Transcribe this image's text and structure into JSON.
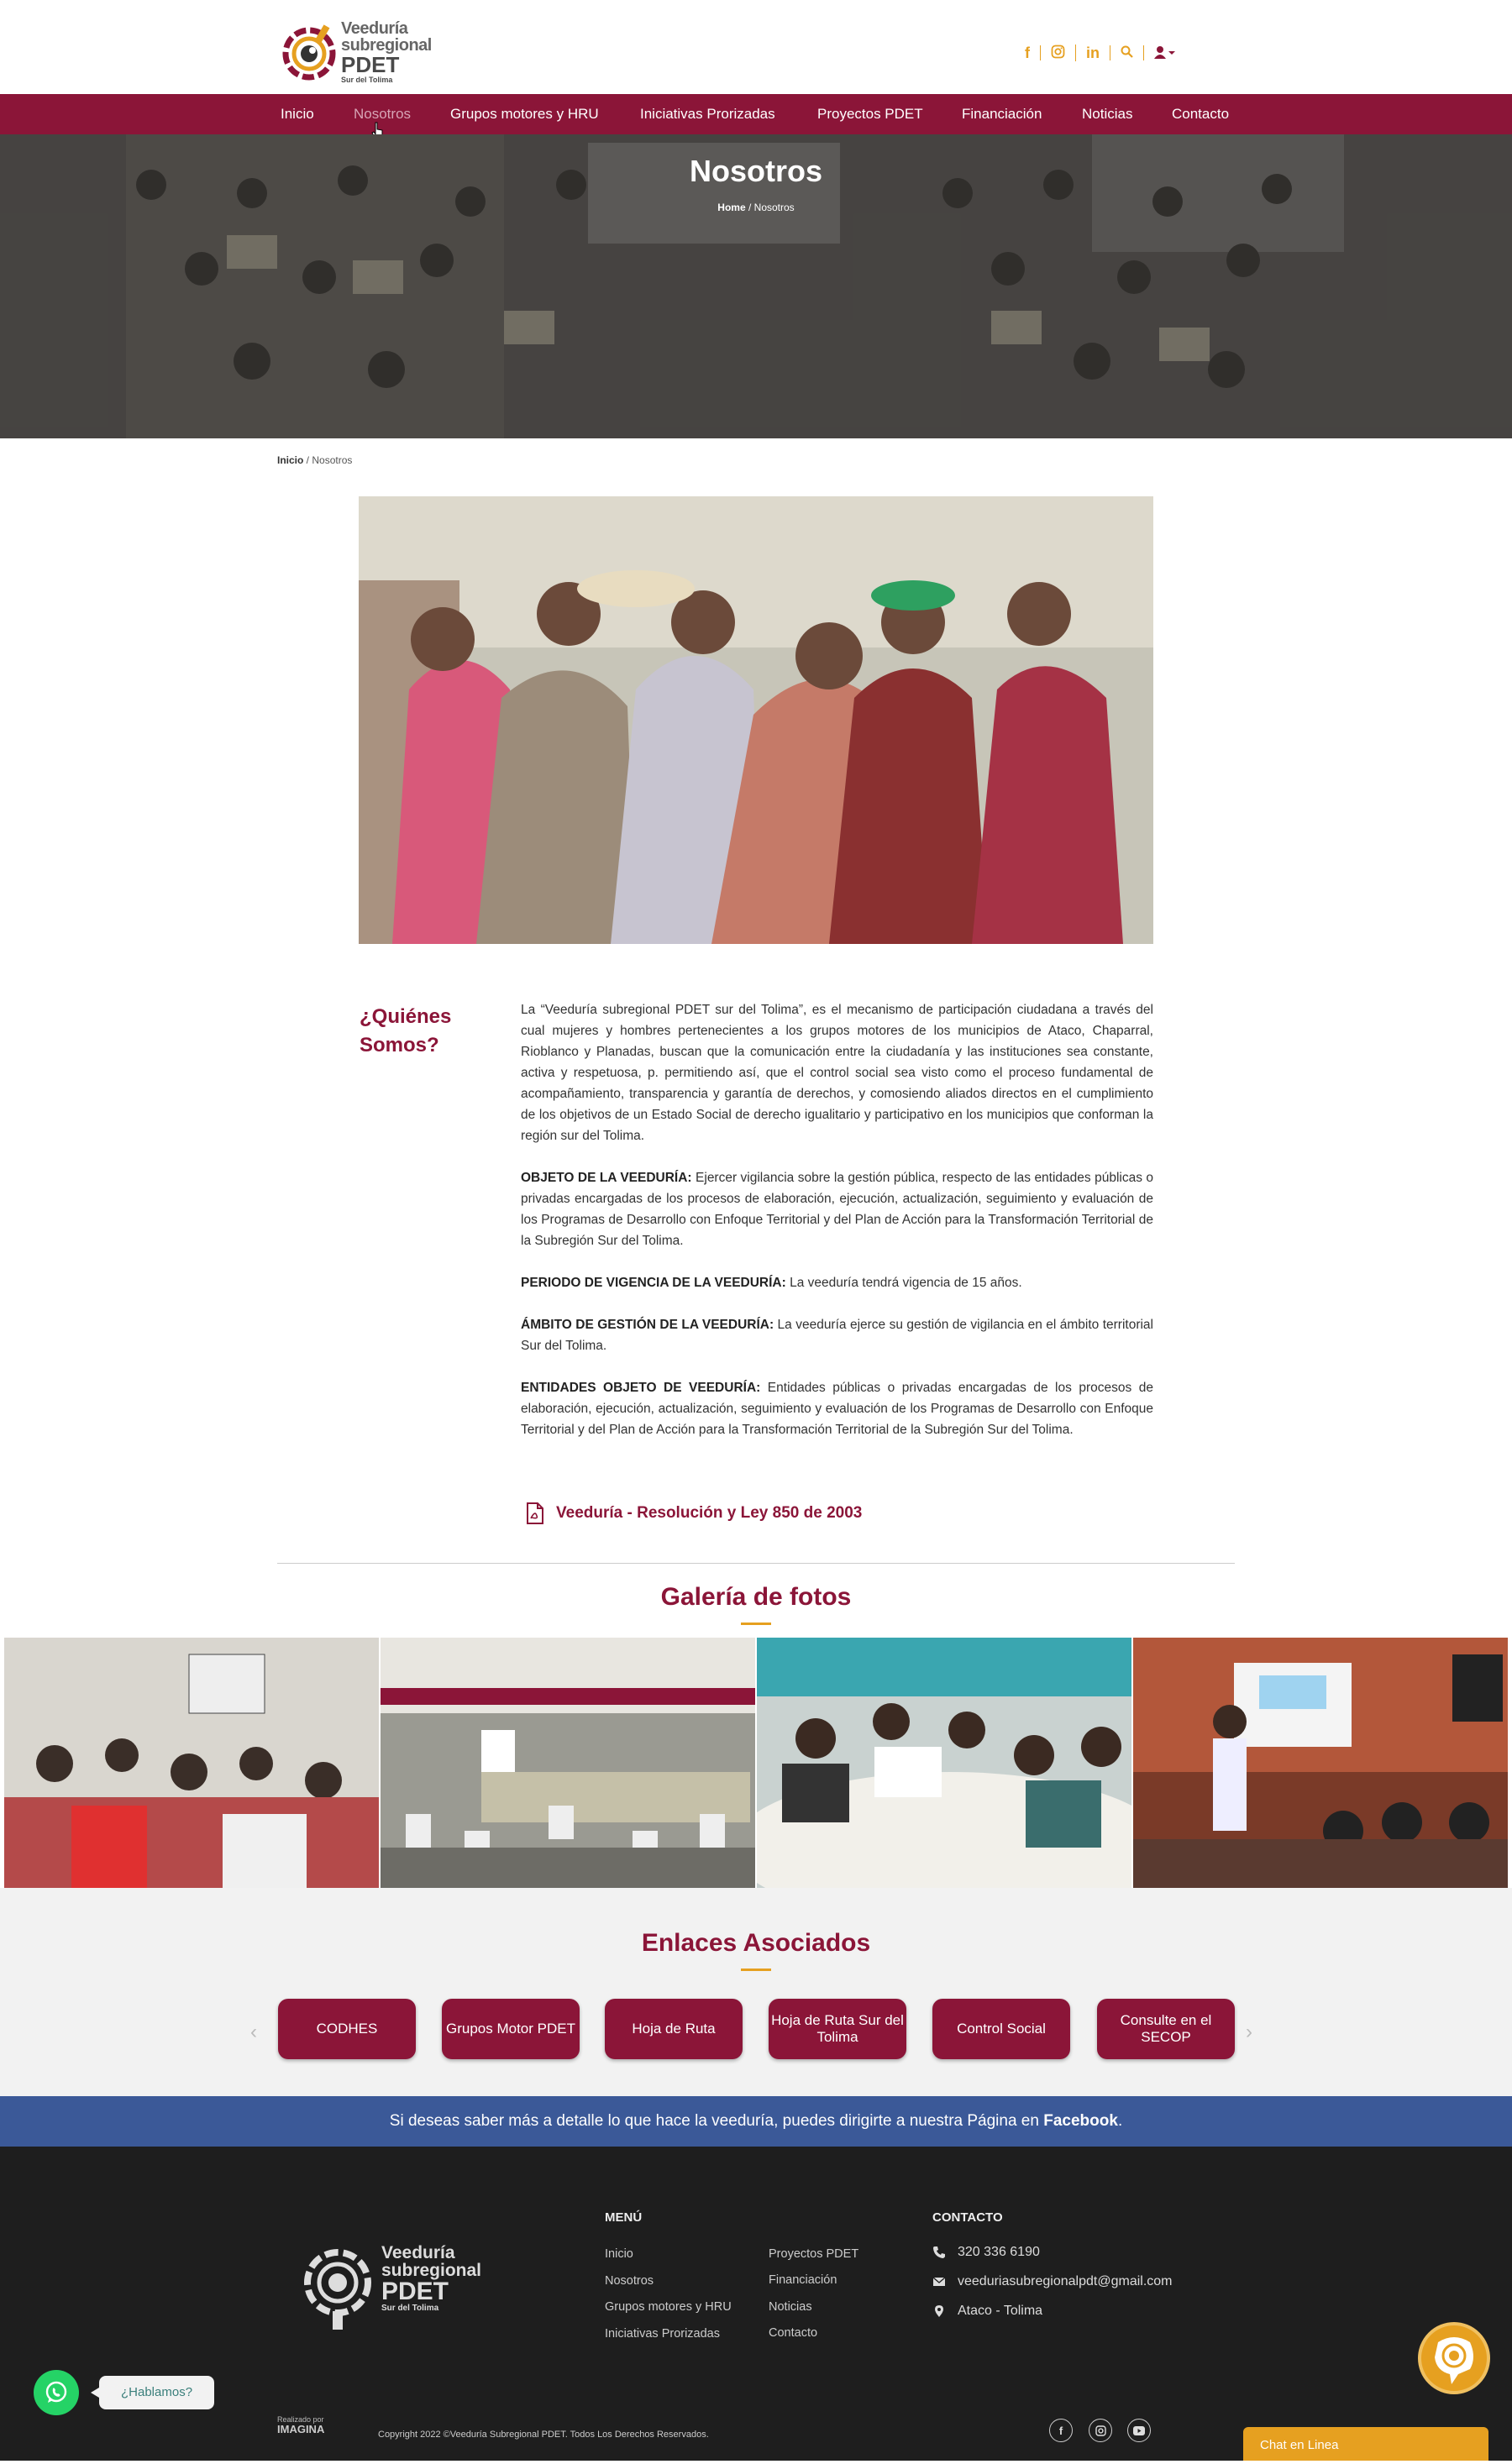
{
  "brand": {
    "line1": "Veeduría",
    "line2": "subregional",
    "line3": "PDET",
    "line4": "Sur del Tolima",
    "colors": {
      "primary": "#8b1538",
      "accent": "#e6a020",
      "facebook": "#3b5998",
      "footer": "#1e1e1e"
    }
  },
  "header_icons": [
    "facebook-icon",
    "instagram-icon",
    "linkedin-icon",
    "search-icon",
    "user-icon"
  ],
  "nav": {
    "items": [
      {
        "label": "Inicio"
      },
      {
        "label": "Nosotros",
        "active": true
      },
      {
        "label": "Grupos motores y HRU"
      },
      {
        "label": "Iniciativas Prorizadas"
      },
      {
        "label": "Proyectos PDET"
      },
      {
        "label": "Financiación"
      },
      {
        "label": "Noticias"
      },
      {
        "label": "Contacto"
      }
    ]
  },
  "hero": {
    "title": "Nosotros",
    "crumb_home": "Home",
    "crumb_sep": " / ",
    "crumb_current": "Nosotros"
  },
  "breadcrumb": {
    "home": "Inicio",
    "sep": " / ",
    "current": "Nosotros"
  },
  "about": {
    "heading": "¿Quiénes Somos?",
    "intro": "La “Veeduría subregional PDET sur del Tolima”, es el mecanismo de participación ciudadana a través del cual mujeres y hombres pertenecientes a los grupos motores de los municipios de Ataco, Chaparral, Rioblanco y Planadas, buscan que la comunicación entre la ciudadanía y las instituciones sea constante, activa y respetuosa, p.  permitiendo así, que el control social sea visto como el proceso fundamental de acompañamiento, transparencia y garantía de derechos, y comosiendo aliados directos en el cumplimiento de los objetivos de un Estado Social de derecho igualitario y participativo en los municipios que conforman la región sur del Tolima.",
    "blocks": [
      {
        "label": "OBJETO DE LA VEEDURÍA:",
        "text": " Ejercer vigilancia sobre la gestión pública, respecto de las entidades públicas o privadas encargadas de los procesos de elaboración, ejecución, actualización, seguimiento y evaluación de los Programas de Desarrollo con Enfoque Territorial y del Plan de Acción para la Transformación Territorial de la Subregión Sur del Tolima."
      },
      {
        "label": "PERIODO DE VIGENCIA DE LA VEEDURÍA:",
        "text": " La veeduría tendrá vigencia de 15 años."
      },
      {
        "label": "ÁMBITO DE GESTIÓN DE LA VEEDURÍA:",
        "text": " La veeduría ejerce su gestión de vigilancia en el ámbito territorial Sur del Tolima."
      },
      {
        "label": "ENTIDADES OBJETO DE VEEDURÍA:",
        "text": " Entidades públicas o privadas encargadas de los procesos de elaboración, ejecución, actualización, seguimiento y evaluación de los Programas de Desarrollo con Enfoque Territorial y del Plan de Acción para la Transformación Territorial de la Subregión Sur del Tolima."
      }
    ],
    "pdf_label": "Veeduría - Resolución y Ley 850 de 2003"
  },
  "gallery": {
    "title": "Galería de fotos"
  },
  "links": {
    "title": "Enlaces Asociados",
    "items": [
      {
        "label": "CODHES"
      },
      {
        "label": "Grupos Motor PDET"
      },
      {
        "label": "Hoja de Ruta"
      },
      {
        "label": "Hoja de Ruta Sur del Tolima"
      },
      {
        "label": "Control Social"
      },
      {
        "label": "Consulte en el SECOP"
      }
    ]
  },
  "facebook_bar": {
    "text": "Si deseas saber más a detalle lo que hace la veeduría, puedes dirigirte a nuestra Página en ",
    "link": "Facebook",
    "end": "."
  },
  "footer": {
    "menu_heading": "MENÚ",
    "menu_col1": [
      "Inicio",
      "Nosotros",
      "Grupos motores y HRU",
      "Iniciativas Prorizadas"
    ],
    "menu_col2": [
      "Proyectos PDET",
      "Financiación",
      "Noticias",
      "Contacto"
    ],
    "contact_heading": "CONTACTO",
    "phone": "320 336 6190",
    "email": "veeduriasubregionalpdt@gmail.com",
    "location": "Ataco - Tolima",
    "made_by_label": "Realizado por",
    "made_by_name": "IMAGINA",
    "copyright": "Copyright 2022 ©Veeduría Subregional PDET. Todos Los Derechos Reservados.",
    "social_icons": [
      "facebook-icon",
      "instagram-icon",
      "youtube-icon"
    ]
  },
  "widgets": {
    "whatsapp_label": "¿Hablamos?",
    "chat_label": "Chat en Linea"
  }
}
